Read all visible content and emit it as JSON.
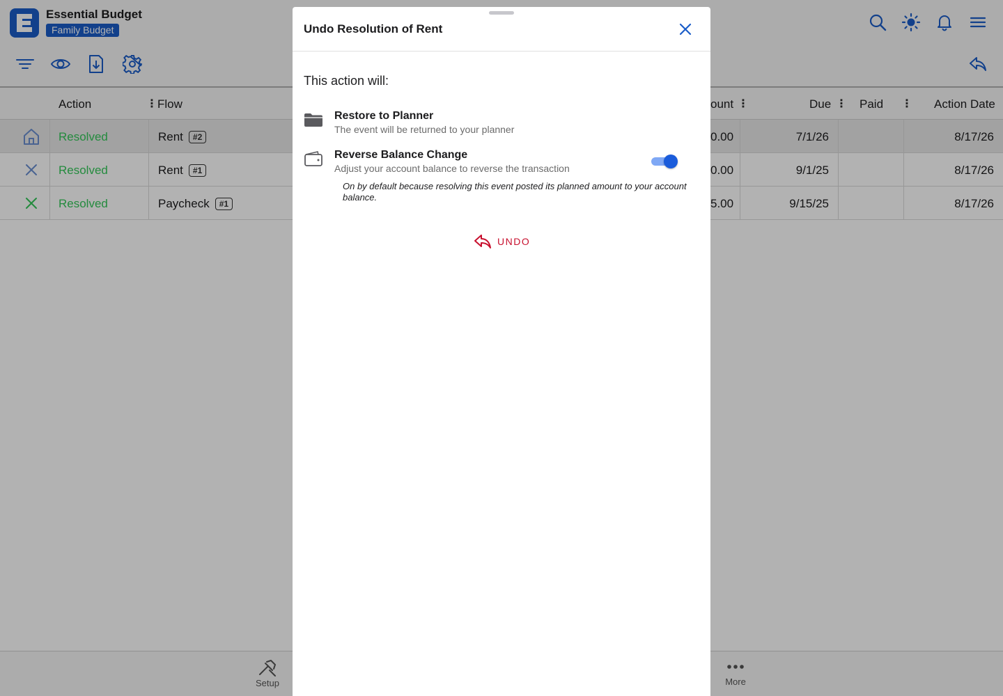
{
  "app": {
    "title": "Essential Budget",
    "budget_name": "Family Budget"
  },
  "table": {
    "columns": {
      "action": "Action",
      "flow": "Flow",
      "amount": "ount",
      "due": "Due",
      "paid": "Paid",
      "action_date": "Action Date"
    },
    "rows": [
      {
        "icon": "home-icon",
        "action": "Resolved",
        "flow": "Rent",
        "tag": "#2",
        "amount": "0.00",
        "due": "7/1/26",
        "paid": "",
        "action_date": "8/17/26",
        "highlighted": true
      },
      {
        "icon": "close-icon",
        "action": "Resolved",
        "flow": "Rent",
        "tag": "#1",
        "amount": "0.00",
        "due": "9/1/25",
        "paid": "",
        "action_date": "8/17/26",
        "highlighted": false
      },
      {
        "icon": "close-icon",
        "action": "Resolved",
        "flow": "Paycheck",
        "tag": "#1",
        "amount": "5.00",
        "due": "9/15/25",
        "paid": "",
        "action_date": "8/17/26",
        "highlighted": false
      }
    ]
  },
  "bottom_nav": {
    "setup": "Setup",
    "more": "More"
  },
  "modal": {
    "title": "Undo Resolution of Rent",
    "intro": "This action will:",
    "restore": {
      "title": "Restore to Planner",
      "subtitle": "The event will be returned to your planner"
    },
    "reverse": {
      "title": "Reverse Balance Change",
      "subtitle": "Adjust your account balance to reverse the transaction",
      "note": "On by default because resolving this event posted its planned amount to your account balance.",
      "enabled": true
    },
    "undo_label": "UNDO"
  },
  "colors": {
    "brand": "#1a5cc8",
    "resolved": "#34c759",
    "danger": "#c8102e",
    "toggle_on": "#1a5cdb"
  }
}
